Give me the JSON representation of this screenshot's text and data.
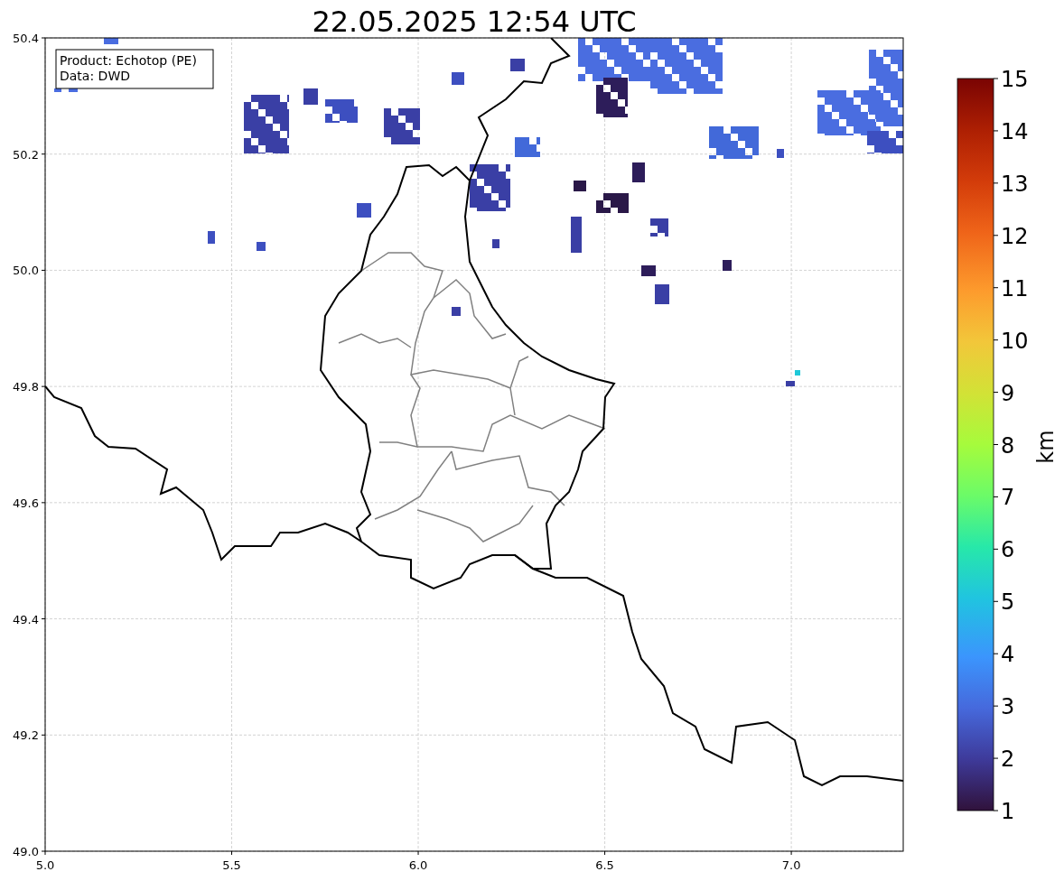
{
  "title": "22.05.2025 12:54 UTC",
  "info_box": [
    "Product: Echotop (PE)",
    "Data: DWD"
  ],
  "x_ticks": [
    "5.0",
    "5.5",
    "6.0",
    "6.5",
    "7.0"
  ],
  "y_ticks": [
    "50.4",
    "50.2",
    "50.0",
    "49.8",
    "49.6",
    "49.4",
    "49.2",
    "49.0"
  ],
  "colorbar": {
    "label": "km",
    "ticks": [
      "15",
      "14",
      "13",
      "12",
      "11",
      "10",
      "9",
      "8",
      "7",
      "6",
      "5",
      "4",
      "3",
      "2",
      "1"
    ]
  }
}
